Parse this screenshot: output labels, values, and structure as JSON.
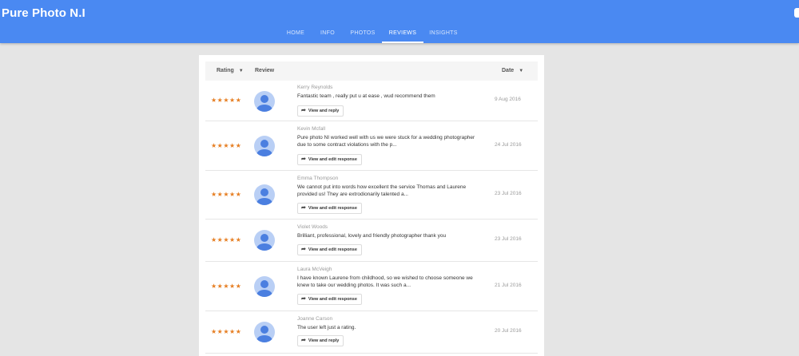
{
  "app": {
    "title": "Pure Photo N.I"
  },
  "nav": {
    "tabs": [
      {
        "label": "HOME"
      },
      {
        "label": "INFO"
      },
      {
        "label": "PHOTOS"
      },
      {
        "label": "REVIEWS",
        "active": true
      },
      {
        "label": "INSIGHTS"
      }
    ]
  },
  "colors": {
    "header": "#4a89f2",
    "star": "#e67e22",
    "background": "#e5e5e5"
  },
  "table": {
    "headers": {
      "rating": "Rating",
      "review": "Review",
      "date": "Date"
    },
    "sort_icon": "caret-down-icon"
  },
  "reviews": [
    {
      "stars": "★★★★★",
      "rating": 5,
      "name": "Kerry Reynolds",
      "text": "Fantastic team , really put u at ease , wud recommend them",
      "button": "View and reply",
      "date": "9 Aug 2016"
    },
    {
      "stars": "★★★★★",
      "rating": 5,
      "name": "Kevin Mcfall",
      "text": "Pure photo NI worked well with us we were stuck for a wedding photographer due to some contract violations with the p...",
      "button": "View and edit response",
      "date": "24 Jul 2016"
    },
    {
      "stars": "★★★★★",
      "rating": 5,
      "name": "Emma Thompson",
      "text": "We cannot put into words how excellent the service Thomas and Laurene provided us! They are extrodionarily talented a...",
      "button": "View and edit response",
      "date": "23 Jul 2016"
    },
    {
      "stars": "★★★★★",
      "rating": 5,
      "name": "Violet Woods",
      "text": "Brilliant, professional, lovely and friendly photographer thank you",
      "button": "View and edit response",
      "date": "23 Jul 2016"
    },
    {
      "stars": "★★★★★",
      "rating": 5,
      "name": "Laura McVeigh",
      "text": "I have known Laurene from childhood, so we wished to choose someone we knew to take our wedding photos. It was such a...",
      "button": "View and edit response",
      "date": "21 Jul 2016"
    },
    {
      "stars": "★★★★★",
      "rating": 5,
      "name": "Joanne Carson",
      "text": "The user left just a rating.",
      "button": "View and reply",
      "date": "20 Jul 2016"
    }
  ]
}
